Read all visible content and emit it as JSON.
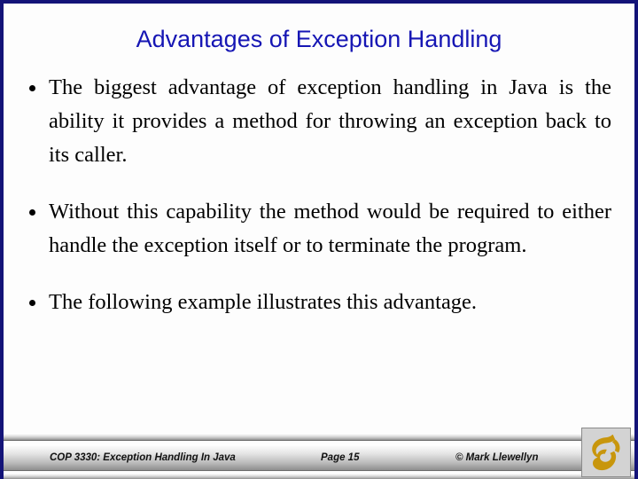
{
  "slide": {
    "title": "Advantages of Exception Handling",
    "title_color": "#1616b4",
    "background_color": "#fdfdfd",
    "border_color": "#131378",
    "bullets": [
      {
        "marker": "bullet-dot",
        "text": "The biggest advantage of exception handling in Java is the ability it provides a method for throwing an exception back to its caller."
      },
      {
        "marker": "bullet-dot",
        "text": "Without this capability the method would be required to either handle the exception itself or to terminate the program."
      },
      {
        "marker": "bullet-dot",
        "text": "The following example illustrates this advantage."
      }
    ]
  },
  "footer": {
    "course": "COP 3330:  Exception Handling In Java",
    "page": "Page 15",
    "copyright": "© Mark Llewellyn",
    "logo_name": "ucf-pegasus-logo",
    "logo_color": "#c8960c"
  }
}
